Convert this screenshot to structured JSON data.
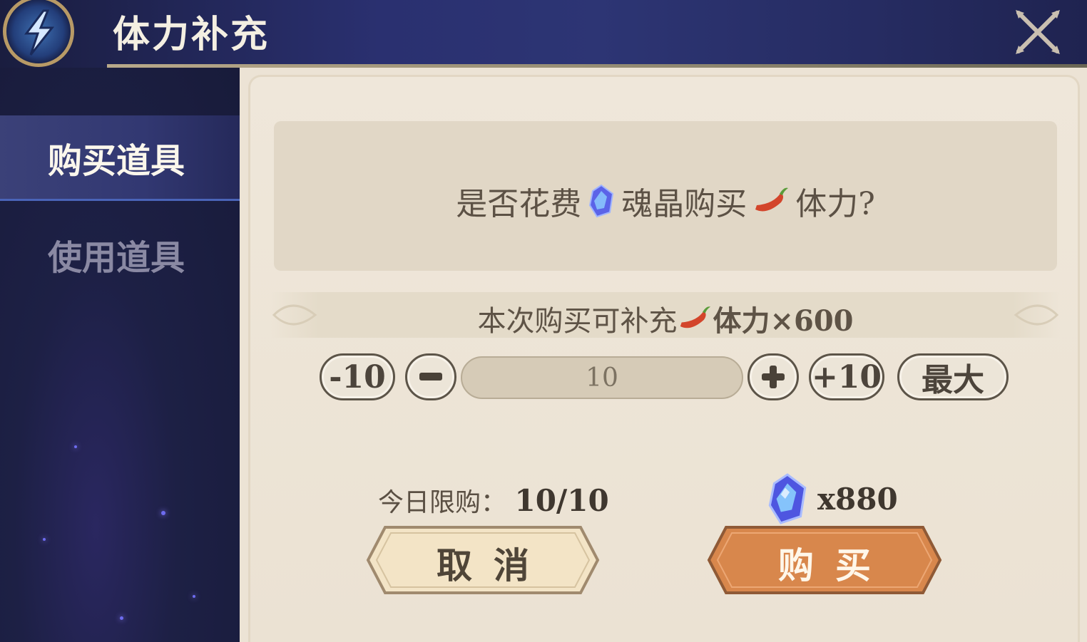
{
  "header": {
    "title": "体力补充"
  },
  "sidebar": {
    "items": [
      {
        "label": "购买道具",
        "active": true
      },
      {
        "label": "使用道具",
        "active": false
      }
    ]
  },
  "dialog": {
    "question": {
      "prefix": "是否花费",
      "middle": "魂晶购买",
      "suffix": "体力?"
    },
    "info": {
      "prefix": "本次购买可补充",
      "suffix": "体力×600"
    },
    "quantity": {
      "minus10_label": "-10",
      "plus10_label": "+10",
      "max_label": "最大",
      "value": "10"
    },
    "limit": {
      "label": "今日限购：",
      "value": "10/10"
    },
    "cost": {
      "value": "x880"
    },
    "cancel_label": "取消",
    "buy_label": "购买"
  },
  "colors": {
    "accent_buy": "#d8874c",
    "cancel_bg": "#f3e4c6",
    "header_bg": "#2a3070"
  },
  "icons": [
    "lightning-emblem-icon",
    "close-icon",
    "soul-crystal-icon",
    "stamina-pepper-icon",
    "minus-icon",
    "plus-icon"
  ]
}
